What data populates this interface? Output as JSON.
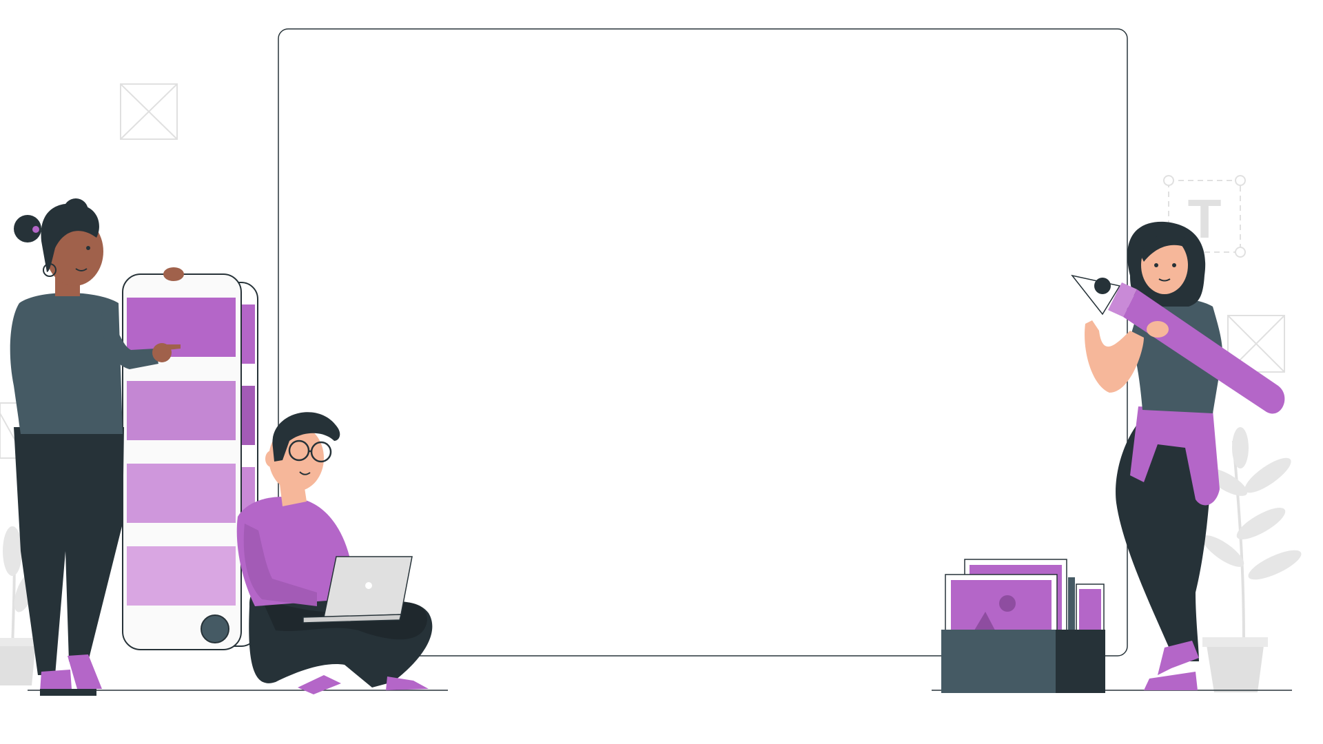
{
  "scene": {
    "description_labels": [],
    "text_tool_glyph": "T"
  },
  "colors": {
    "purple": "#b466c8",
    "purple_light": "#c98ad7",
    "purple_lighter": "#d39ade",
    "purple_lightest": "#d9a6e2",
    "dark": "#263238",
    "slate": "#455a64",
    "skin_dark": "#a0614b",
    "skin_light": "#f6b79a",
    "gray_deco": "#e0e0e0",
    "white": "#ffffff"
  },
  "icons": [
    "image-placeholder-icon",
    "text-tool-icon",
    "pen-nib-icon",
    "plant-icon",
    "laptop-icon",
    "color-swatch-icon",
    "photo-box-icon"
  ]
}
